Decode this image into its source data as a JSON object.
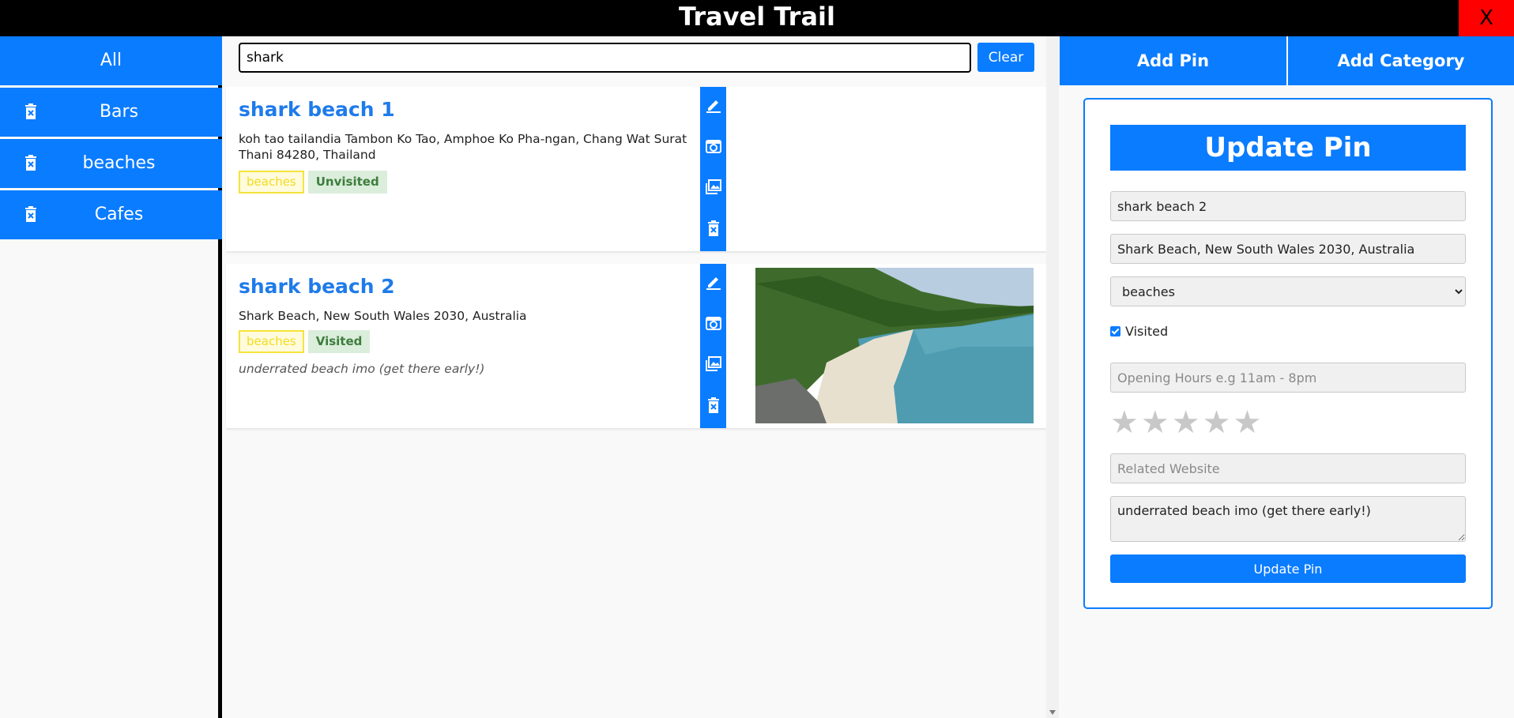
{
  "header": {
    "title": "Travel Trail",
    "close_label": "X"
  },
  "sidebar": {
    "items": [
      {
        "label": "All"
      },
      {
        "label": "Bars"
      },
      {
        "label": "beaches"
      },
      {
        "label": "Cafes"
      }
    ]
  },
  "search": {
    "value": "shark",
    "clear_label": "Clear"
  },
  "pins": [
    {
      "name": "shark beach 1",
      "address": "koh tao tailandia Tambon Ko Tao, Amphoe Ko Pha-ngan, Chang Wat Surat Thani 84280, Thailand",
      "category": "beaches",
      "status": "Unvisited",
      "note": ""
    },
    {
      "name": "shark beach 2",
      "address": "Shark Beach, New South Wales 2030, Australia",
      "category": "beaches",
      "status": "Visited",
      "note": "underrated beach imo (get there early!)"
    }
  ],
  "right_panel": {
    "tabs": {
      "add_pin": "Add Pin",
      "add_category": "Add Category"
    },
    "form": {
      "title": "Update Pin",
      "name_value": "shark beach 2",
      "address_value": "Shark Beach, New South Wales 2030, Australia",
      "category_selected": "beaches",
      "visited_label": "Visited",
      "visited_checked": true,
      "hours_placeholder": "Opening Hours e.g 11am - 8pm",
      "rating": 0,
      "rating_max": 5,
      "website_placeholder": "Related Website",
      "notes_value": "underrated beach imo (get there early!)",
      "submit_label": "Update Pin"
    }
  },
  "colors": {
    "accent": "#0a7cff",
    "close": "#ff0000",
    "title_bar": "#000000"
  }
}
